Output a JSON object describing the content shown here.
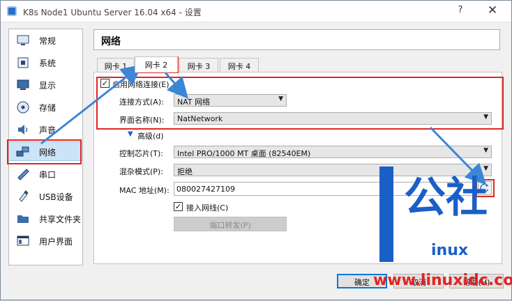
{
  "window": {
    "title": "K8s Node1 Ubuntu Server 16.04 x64 - 设置",
    "help_label": "?",
    "close_label": "✕"
  },
  "sidebar": {
    "items": [
      {
        "label": "常规",
        "icon": "monitor-icon"
      },
      {
        "label": "系统",
        "icon": "chip-icon"
      },
      {
        "label": "显示",
        "icon": "display-icon"
      },
      {
        "label": "存储",
        "icon": "disk-icon"
      },
      {
        "label": "声音",
        "icon": "speaker-icon"
      },
      {
        "label": "网络",
        "icon": "network-icon"
      },
      {
        "label": "串口",
        "icon": "serial-port-icon"
      },
      {
        "label": "USB设备",
        "icon": "usb-icon"
      },
      {
        "label": "共享文件夹",
        "icon": "folder-icon"
      },
      {
        "label": "用户界面",
        "icon": "window-icon"
      }
    ],
    "selected_index": 5
  },
  "page_title": "网络",
  "tabs": [
    {
      "label": "网卡 1"
    },
    {
      "label": "网卡 2"
    },
    {
      "label": "网卡 3"
    },
    {
      "label": "网卡 4"
    }
  ],
  "active_tab_index": 1,
  "form": {
    "enable_label": "启用网络连接(E)",
    "enable_checked": true,
    "attached_label": "连接方式(A):",
    "attached_value": "NAT 网络",
    "name_label": "界面名称(N):",
    "name_value": "NatNetwork",
    "advanced_label": "高级(d)",
    "adapter_label": "控制芯片(T):",
    "adapter_value": "Intel PRO/1000 MT 桌面 (82540EM)",
    "promisc_label": "混杂模式(P):",
    "promisc_value": "拒绝",
    "mac_label": "MAC 地址(M):",
    "mac_value": "080027427109",
    "cable_label": "接入网线(C)",
    "cable_checked": true,
    "port_forward_label": "端口转发(P)"
  },
  "buttons": {
    "ok": "确定",
    "cancel": "取消",
    "help": "帮助(H)"
  },
  "watermark": {
    "big_text": "公社",
    "small_text": "inux",
    "url": "www.linuxidc.com"
  },
  "colors": {
    "highlight": "#e02424",
    "arrow": "#3b86d6",
    "watermark_blue": "#1a5fc8"
  }
}
